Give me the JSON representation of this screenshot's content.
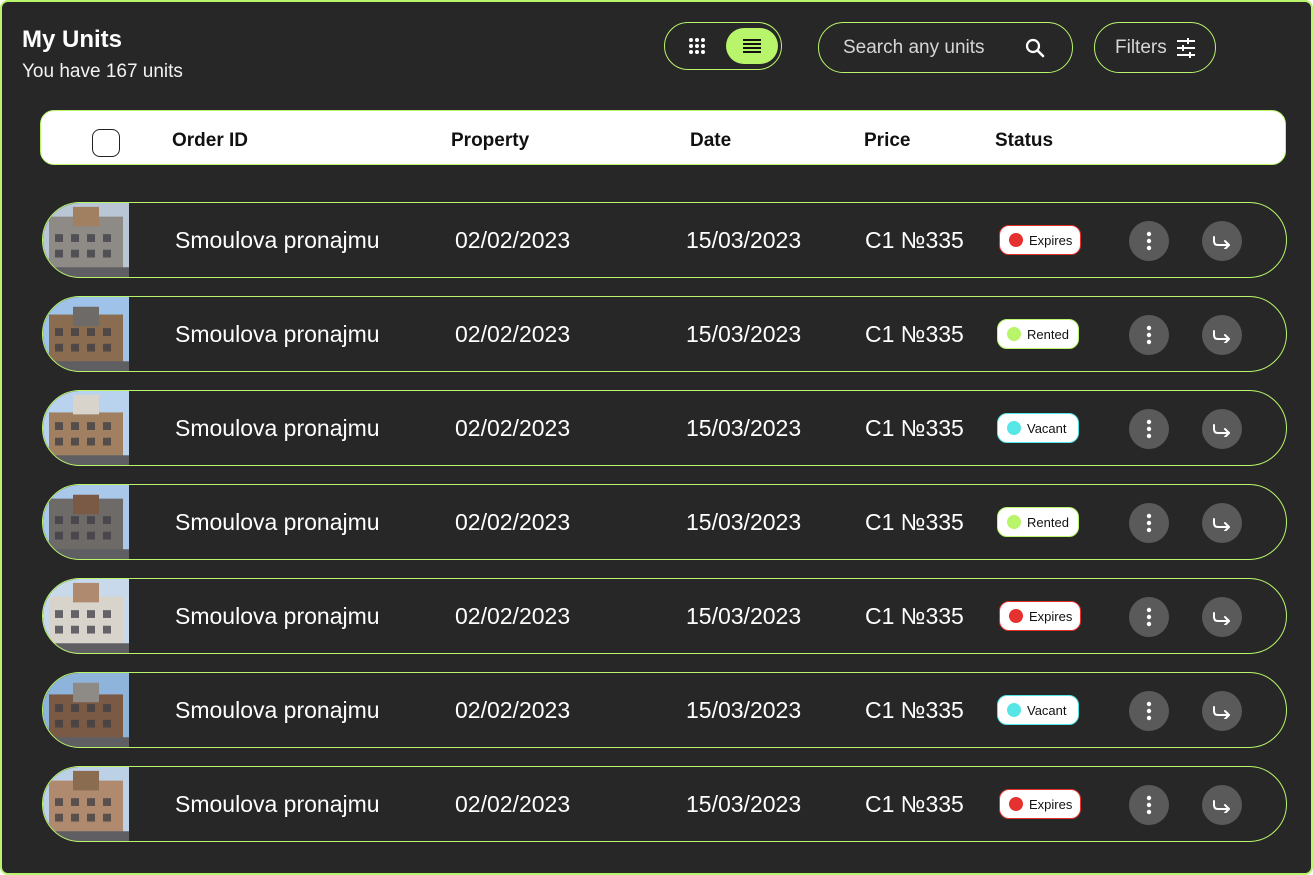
{
  "header": {
    "title": "My Units",
    "subtitle": "You have 167 units"
  },
  "view_toggle": {
    "active": "list"
  },
  "search": {
    "placeholder": "Search any units"
  },
  "filters": {
    "label": "Filters"
  },
  "table": {
    "columns": [
      "Order ID",
      "Property",
      "Date",
      "Price",
      "Status"
    ],
    "rows": [
      {
        "name": "Smoulova pronajmu",
        "order_date": "02/02/2023",
        "date": "15/03/2023",
        "price": "C1 №335",
        "status": "Expires",
        "status_color": "#e5322f",
        "thumb": "building-1"
      },
      {
        "name": "Smoulova pronajmu",
        "order_date": "02/02/2023",
        "date": "15/03/2023",
        "price": "C1 №335",
        "status": "Rented",
        "status_color": "#b8f56b",
        "thumb": "building-2"
      },
      {
        "name": "Smoulova pronajmu",
        "order_date": "02/02/2023",
        "date": "15/03/2023",
        "price": "C1 №335",
        "status": "Vacant",
        "status_color": "#57e6e6",
        "thumb": "building-3"
      },
      {
        "name": "Smoulova pronajmu",
        "order_date": "02/02/2023",
        "date": "15/03/2023",
        "price": "C1 №335",
        "status": "Rented",
        "status_color": "#b8f56b",
        "thumb": "building-4"
      },
      {
        "name": "Smoulova pronajmu",
        "order_date": "02/02/2023",
        "date": "15/03/2023",
        "price": "C1 №335",
        "status": "Expires",
        "status_color": "#e5322f",
        "thumb": "building-5"
      },
      {
        "name": "Smoulova pronajmu",
        "order_date": "02/02/2023",
        "date": "15/03/2023",
        "price": "C1 №335",
        "status": "Vacant",
        "status_color": "#57e6e6",
        "thumb": "building-6"
      },
      {
        "name": "Smoulova pronajmu",
        "order_date": "02/02/2023",
        "date": "15/03/2023",
        "price": "C1 №335",
        "status": "Expires",
        "status_color": "#e5322f",
        "thumb": "building-7"
      }
    ]
  },
  "colors": {
    "background": "#272727",
    "accent": "#b8f56b",
    "expires": "#e5322f",
    "rented": "#b8f56b",
    "vacant": "#57e6e6",
    "action_button": "#5a5a5a"
  },
  "icons": {
    "grid": "grid-icon",
    "list": "list-icon",
    "search": "search-icon",
    "filters": "sliders-icon",
    "more": "more-vertical-icon",
    "share": "share-arrow-icon"
  }
}
